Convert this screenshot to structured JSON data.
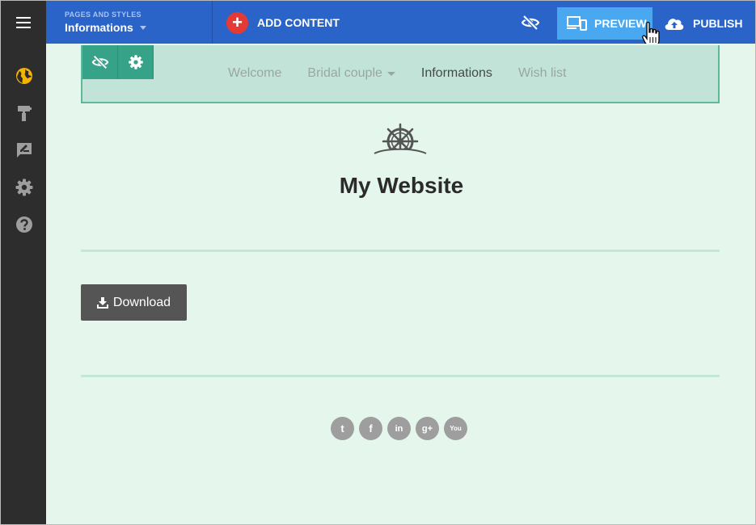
{
  "topbar": {
    "menu_icon": "hamburger-menu-icon",
    "pages_label": "PAGES AND STYLES",
    "current_page": "Informations",
    "add_content": {
      "symbol": "+",
      "label": "ADD CONTENT"
    },
    "visibility_icon": "eye-off-icon",
    "preview": {
      "icon": "devices-icon",
      "label": "PREVIEW"
    },
    "publish": {
      "icon": "cloud-upload-icon",
      "label": "PUBLISH"
    }
  },
  "sidebar": {
    "items": [
      {
        "icon": "globe-icon",
        "active": true
      },
      {
        "icon": "paint-roller-icon",
        "active": false
      },
      {
        "icon": "edit-note-icon",
        "active": false
      },
      {
        "icon": "gear-icon",
        "active": false
      },
      {
        "icon": "help-icon",
        "active": false
      }
    ]
  },
  "site": {
    "nav": {
      "tools": [
        "eye-off-icon",
        "gear-icon"
      ],
      "links": [
        {
          "label": "Welcome",
          "has_dropdown": false,
          "active": false
        },
        {
          "label": "Bridal couple",
          "has_dropdown": true,
          "active": false
        },
        {
          "label": "Informations",
          "has_dropdown": false,
          "active": true
        },
        {
          "label": "Wish list",
          "has_dropdown": false,
          "active": false
        }
      ]
    },
    "logo_icon": "ship-wheel-icon",
    "title": "My Website",
    "download": {
      "icon": "download-icon",
      "label": "Download"
    },
    "social": [
      {
        "name": "twitter-icon",
        "glyph": "t"
      },
      {
        "name": "facebook-icon",
        "glyph": "f"
      },
      {
        "name": "linkedin-icon",
        "glyph": "in"
      },
      {
        "name": "google-plus-icon",
        "glyph": "g+"
      },
      {
        "name": "youtube-icon",
        "glyph": "You"
      }
    ]
  },
  "colors": {
    "topbar": "#2b64c8",
    "sidebar": "#2d2d2d",
    "preview_button": "#4aa8f0",
    "content_bg": "#e5f6ec",
    "nav_bg": "#c2e4d8",
    "nav_tools": "#36a388",
    "add_content": "#e53935",
    "sidebar_active_icon": "#f4b400"
  }
}
